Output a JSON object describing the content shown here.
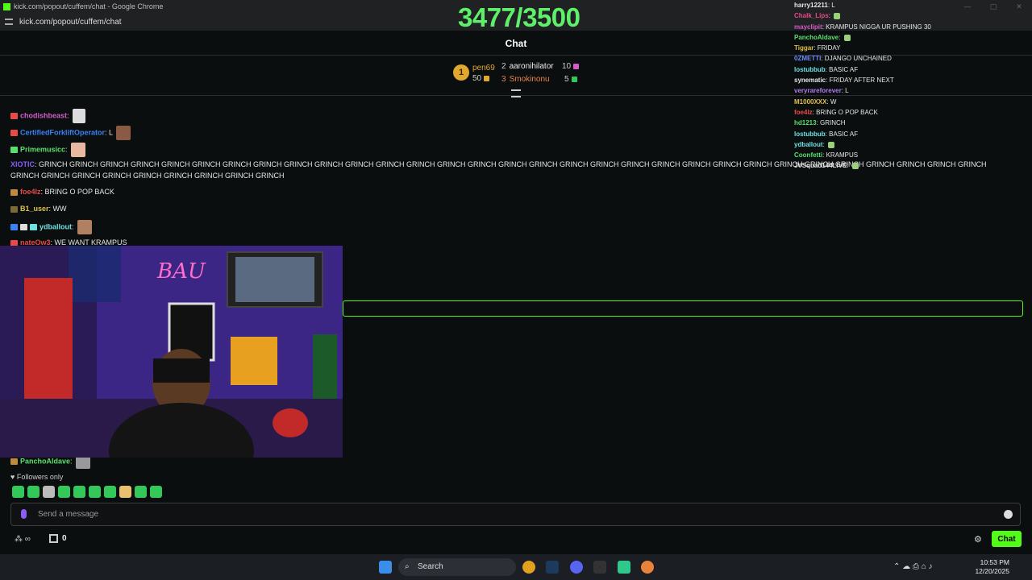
{
  "window": {
    "title": "kick.com/popout/cuffem/chat - Google Chrome",
    "url": "kick.com/popout/cuffem/chat"
  },
  "header": {
    "goal": "3477/3500",
    "title": "Chat"
  },
  "leaderboard": {
    "first": {
      "rank": "1",
      "name": "pen69",
      "amount": "50"
    },
    "second": {
      "rank": "2",
      "name": "aaronihilator",
      "amount": "10"
    },
    "third": {
      "rank": "3",
      "name": "Smokinonu",
      "amount": "5"
    }
  },
  "chat": {
    "messages": [
      {
        "user": "chodishbeast",
        "text": "",
        "color": "#d55ac9"
      },
      {
        "user": "CertifiedForkliftOperator",
        "text": "L",
        "color": "#3b82f6"
      },
      {
        "user": "Primemusicc",
        "text": "",
        "color": "#58e06c"
      },
      {
        "user": "XIOTIC",
        "text": "GRINCH GRINCH GRINCH GRINCH GRINCH GRINCH GRINCH GRINCH GRINCH GRINCH GRINCH GRINCH GRINCH GRINCH GRINCH GRINCH GRINCH GRINCH GRINCH GRINCH GRINCH GRINCH GRINCH GRINCH GRINCH GRINCH GRINCH GRINCH GRINCH GRINCH GRINCH GRINCH GRINCH GRINCH GRINCH GRINCH GRINCH GRINCH GRINCH GRINCH",
        "color": "#8b5cf6"
      },
      {
        "user": "foe4lz",
        "text": "BRING O POP BACK",
        "color": "#e84a4a"
      },
      {
        "user": "B1_user",
        "text": "WW",
        "color": "#e0c04a"
      },
      {
        "user": "ydballout",
        "text": "",
        "color": "#6fe0e0"
      },
      {
        "user": "nateOw3",
        "text": "WE WANT KRAMPUS",
        "color": "#e84a4a"
      },
      {
        "user": "PanchoAldave",
        "text": "",
        "color": "#58e06c"
      }
    ]
  },
  "overlay": {
    "rows": [
      {
        "user": "harry12211",
        "text": "L",
        "color": "#e6e6e6"
      },
      {
        "user": "Chalk_Lips",
        "text": "",
        "color": "#e84a8a"
      },
      {
        "user": "mayclipit",
        "text": "KRAMPUS NIGGA UR PUSHING 30",
        "color": "#d55ac9"
      },
      {
        "user": "PanchoAldave",
        "text": "",
        "color": "#58e06c"
      },
      {
        "user": "Tiggar",
        "text": "FRIDAY",
        "color": "#e0c04a"
      },
      {
        "user": "0ZMETTI",
        "text": "DJANGO UNCHAINED",
        "color": "#6b8cff"
      },
      {
        "user": "lostubbub",
        "text": "BASIC AF",
        "color": "#6fe0e0"
      },
      {
        "user": "synematic",
        "text": "FRIDAY AFTER NEXT",
        "color": "#e6e6e6"
      },
      {
        "user": "veryrareforever",
        "text": "L",
        "color": "#b07af0"
      },
      {
        "user": "M1000XXX",
        "text": "W",
        "color": "#e0c04a"
      },
      {
        "user": "foe4lz",
        "text": "BRING O POP BACK",
        "color": "#e84a4a"
      },
      {
        "user": "hd1213",
        "text": "GRINCH",
        "color": "#58e06c"
      },
      {
        "user": "lostubbub",
        "text": "BASIC AF",
        "color": "#6fe0e0"
      },
      {
        "user": "ydballout",
        "text": "",
        "color": "#6fe0e0"
      },
      {
        "user": "Coonfetti",
        "text": "KRAMPUS",
        "color": "#58e06c"
      },
      {
        "user": "JVSquad144LIVE",
        "text": "",
        "color": "#e6e6e6"
      }
    ]
  },
  "footer": {
    "followers": "Followers only",
    "input_placeholder": "Send a message",
    "count": "0",
    "chat_button": "Chat"
  },
  "taskbar": {
    "search": "Search",
    "time": "10:53 PM",
    "date": "12/20/2025"
  }
}
